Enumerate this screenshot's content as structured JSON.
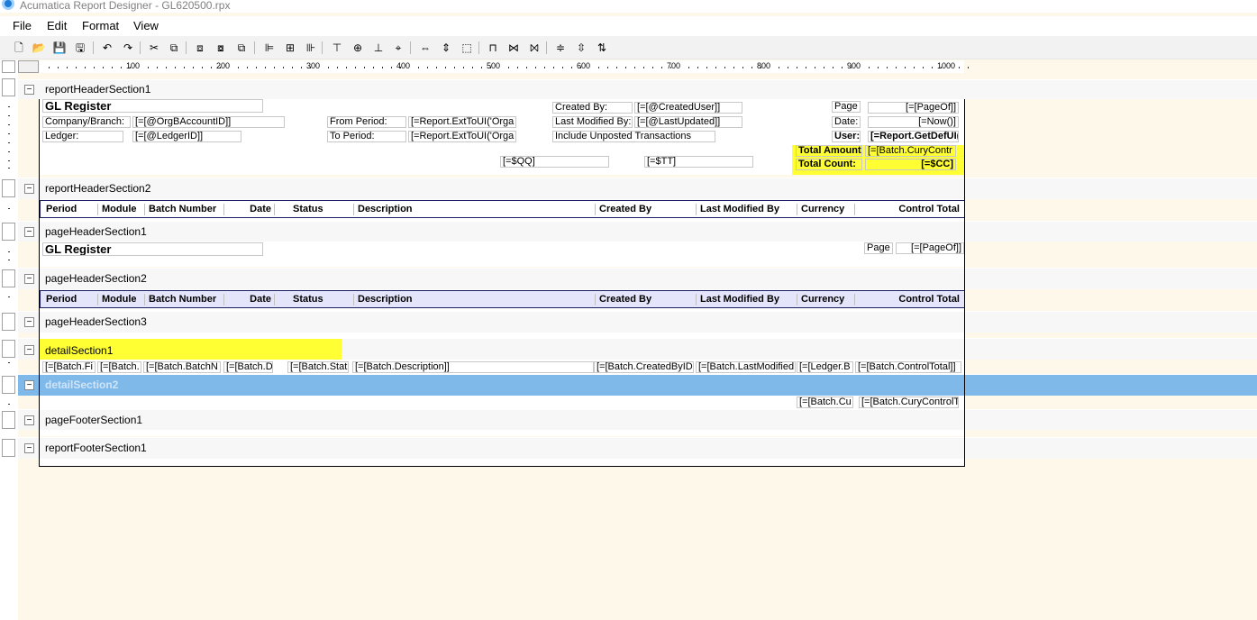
{
  "window": {
    "title": "Acumatica Report Designer - GL620500.rpx"
  },
  "menu": [
    "File",
    "Edit",
    "Format",
    "View"
  ],
  "toolbar": [
    {
      "name": "new-report-icon",
      "glyph": "🗋"
    },
    {
      "name": "open-icon",
      "glyph": "📂"
    },
    {
      "name": "save-icon",
      "glyph": "💾"
    },
    {
      "name": "save-as-icon",
      "glyph": "🖫"
    },
    {
      "name": "undo-icon",
      "glyph": "↶"
    },
    {
      "name": "redo-icon",
      "glyph": "↷"
    },
    {
      "name": "cut-icon",
      "glyph": "✂"
    },
    {
      "name": "copy-icon",
      "glyph": "⧉"
    },
    {
      "name": "bring-front-icon",
      "glyph": "⧈"
    },
    {
      "name": "send-back-icon",
      "glyph": "⧇"
    },
    {
      "name": "group-icon",
      "glyph": "⧉"
    },
    {
      "name": "align-left-icon",
      "glyph": "⊫"
    },
    {
      "name": "align-center-icon",
      "glyph": "⊞"
    },
    {
      "name": "align-right-icon",
      "glyph": "⊪"
    },
    {
      "name": "align-top-icon",
      "glyph": "⊤"
    },
    {
      "name": "align-middle-icon",
      "glyph": "⊕"
    },
    {
      "name": "align-bottom-icon",
      "glyph": "⊥"
    },
    {
      "name": "center-icon",
      "glyph": "⌖"
    },
    {
      "name": "same-width-icon",
      "glyph": "⇔"
    },
    {
      "name": "same-height-icon",
      "glyph": "⇕"
    },
    {
      "name": "same-size-icon",
      "glyph": "⬚"
    },
    {
      "name": "h-spacing-equal-icon",
      "glyph": "⊓"
    },
    {
      "name": "h-spacing-increase-icon",
      "glyph": "⋈"
    },
    {
      "name": "h-spacing-decrease-icon",
      "glyph": "⨝"
    },
    {
      "name": "v-spacing-equal-icon",
      "glyph": "≑"
    },
    {
      "name": "v-spacing-increase-icon",
      "glyph": "⇳"
    },
    {
      "name": "v-spacing-decrease-icon",
      "glyph": "⇅"
    }
  ],
  "ruler": [
    "100",
    "200",
    "300",
    "400",
    "500",
    "600",
    "700",
    "800",
    "900",
    "1000"
  ],
  "sections": {
    "reportHeaderSection1": "reportHeaderSection1",
    "reportHeaderSection2": "reportHeaderSection2",
    "pageHeaderSection1": "pageHeaderSection1",
    "pageHeaderSection2": "pageHeaderSection2",
    "pageHeaderSection3": "pageHeaderSection3",
    "detailSection1": "detailSection1",
    "detailSection2": "detailSection2",
    "pageFooterSection1": "pageFooterSection1",
    "reportFooterSection1": "reportFooterSection1"
  },
  "rh1": {
    "title": "GL Register",
    "company_label": "Company/Branch:",
    "company_value": "[=[@OrgBAccountID]]",
    "ledger_label": "Ledger:",
    "ledger_value": "[=[@LedgerID]]",
    "from_period_label": "From Period:",
    "from_period_value": "[=Report.ExtToUI('Orga",
    "to_period_label": "To Period:",
    "to_period_value": "[=Report.ExtToUI('Orga",
    "created_by_label": "Created By:",
    "created_by_value": "[=[@CreatedUser]]",
    "last_modified_label": "Last Modified By:",
    "last_modified_value": "[=[@LastUpdated]]",
    "include_unposted": "Include Unposted Transactions",
    "page_label": "Page",
    "page_value": "[=[PageOf]]",
    "date_label": "Date:",
    "date_value": "[=Now()]",
    "user_label": "User:",
    "user_value": "[=Report.GetDefUI(",
    "total_amount_label": "Total Amount:",
    "total_amount_value": "[=[Batch.CuryContr",
    "total_count_label": "Total Count:",
    "total_count_value": "[=$CC]",
    "qq_value": "[=$QQ]",
    "tt_value": "[=$TT]"
  },
  "columns": [
    "Period",
    "Module",
    "Batch Number",
    "Date",
    "Status",
    "Description",
    "Created By",
    "Last Modified By",
    "Currency",
    "Control Total"
  ],
  "ph1": {
    "title": "GL Register",
    "page_label": "Page",
    "page_value": "[=[PageOf]]"
  },
  "detail1": [
    "[=[Batch.Fi",
    "[=[Batch.",
    "[=[Batch.BatchN",
    "[=[Batch.D",
    "[=[Batch.Stat",
    "[=[Batch.Description]]",
    "[=[Batch.CreatedByID",
    "[=[Batch.LastModified",
    "[=[Ledger.B",
    "[=[Batch.ControlTotal]]"
  ],
  "detail2": [
    "[=[Batch.Cu",
    "[=[Batch.CuryControlT"
  ],
  "colors": {
    "highlight_yellow": "#ffff33",
    "selected_band": "#7fb9ea",
    "header_row_border": "#1a1f66",
    "header_row_fill": "#e4e4fa",
    "canvas": "#fdf8ea"
  }
}
